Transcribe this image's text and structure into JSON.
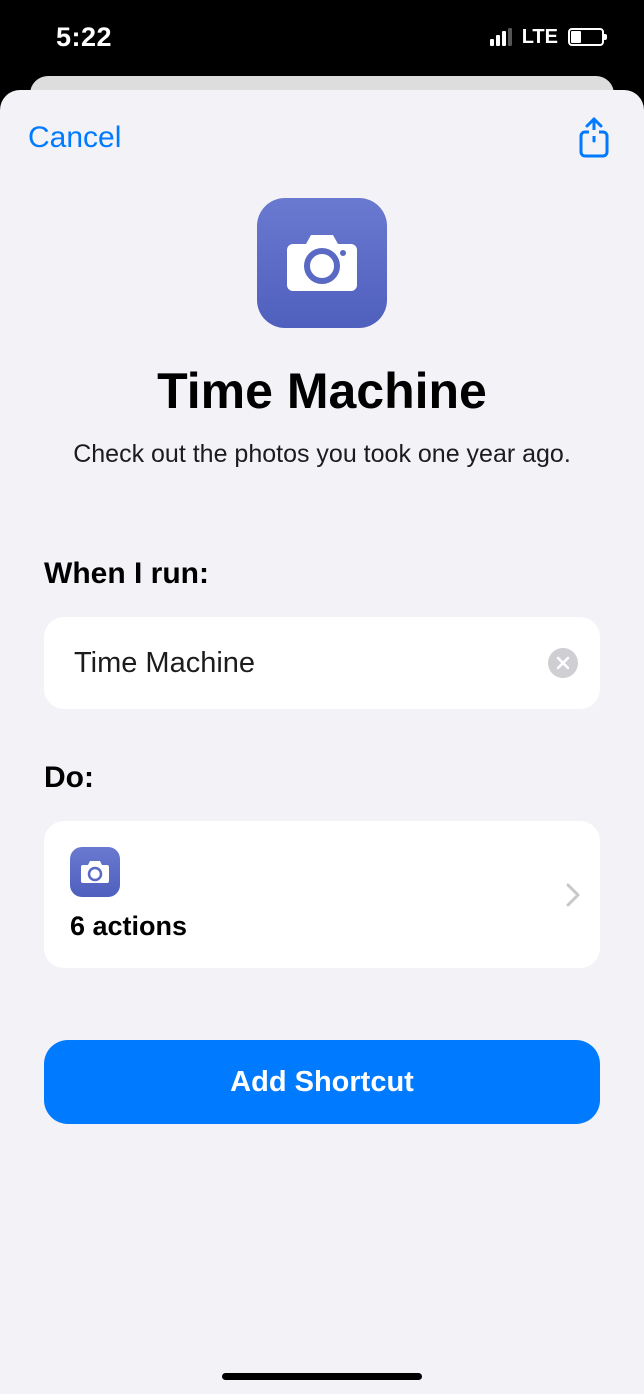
{
  "status": {
    "time": "5:22",
    "network_label": "LTE"
  },
  "header": {
    "cancel_label": "Cancel"
  },
  "hero": {
    "title": "Time Machine",
    "subtitle": "Check out the photos you took one year ago."
  },
  "sections": {
    "when_label": "When I run:",
    "when_value": "Time Machine",
    "do_label": "Do:",
    "actions_count": "6 actions"
  },
  "buttons": {
    "add_label": "Add Shortcut"
  }
}
